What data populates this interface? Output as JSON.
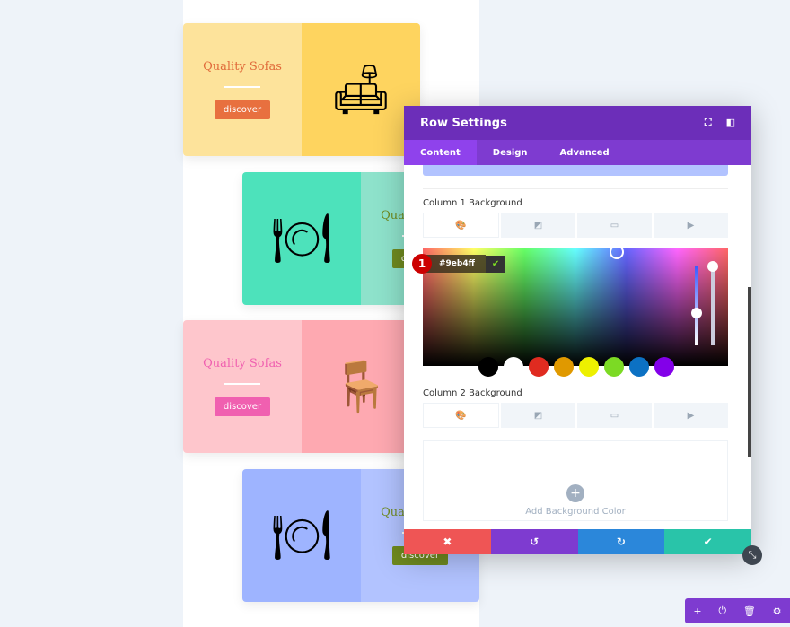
{
  "cards": [
    {
      "title": "Quality Sofas",
      "button": "discover",
      "icon": "sofa-icon",
      "left": "#fde39b",
      "right": "#fed45f",
      "title_color": "#e06a3a",
      "btn_color": "#e8703f",
      "text_side": "left"
    },
    {
      "title": "Quality Sofas",
      "button": "discover",
      "icon": "dining-table-icon",
      "left": "#4de2bb",
      "right": "#8ee2cb",
      "title_color": "#6f8a1f",
      "btn_color": "#6f8a1f",
      "text_side": "right"
    },
    {
      "title": "Quality Sofas",
      "button": "discover",
      "icon": "desk-chair-icon",
      "left": "#fec6cc",
      "right": "#fea9b1",
      "title_color": "#f060b0",
      "btn_color": "#f060b0",
      "text_side": "left"
    },
    {
      "title": "Quality Sofas",
      "button": "discover",
      "icon": "dining-table-icon",
      "left": "#9eb4ff",
      "right": "#b2c3ff",
      "title_color": "#6f8a1f",
      "btn_color": "#6f8a1f",
      "text_side": "right"
    }
  ],
  "modal": {
    "title": "Row Settings",
    "tabs": [
      "Content",
      "Design",
      "Advanced"
    ],
    "col1_label": "Column 1 Background",
    "col2_label": "Column 2 Background",
    "hex_value": "#9eb4ff",
    "step_badge": "1",
    "add_bg": "Add Background Color",
    "swatches": [
      "#000000",
      "#ffffff",
      "#e02b20",
      "#e09900",
      "#edf000",
      "#7cda24",
      "#0c71c3",
      "#8300e9"
    ]
  },
  "footer_colors": [
    "#ef5555",
    "#7e3bd0",
    "#2b87da",
    "#29c4a9"
  ]
}
